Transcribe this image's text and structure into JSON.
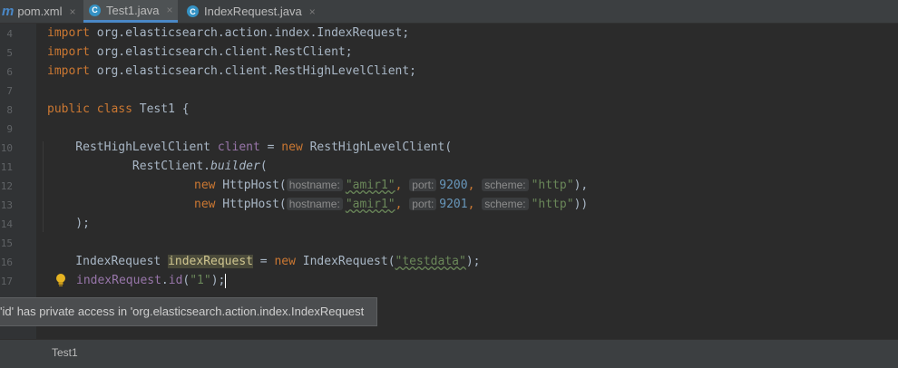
{
  "tabs": [
    {
      "label": "pom.xml",
      "icon": "maven-icon",
      "active": false
    },
    {
      "label": "Test1.java",
      "icon": "java-class-icon",
      "active": true
    },
    {
      "label": "IndexRequest.java",
      "icon": "java-class-icon",
      "active": false
    }
  ],
  "close_glyph": "×",
  "maven_glyph": "m",
  "class_glyph": "C",
  "line_numbers": [
    "4",
    "5",
    "6",
    "7",
    "8",
    "9",
    "10",
    "11",
    "12",
    "13",
    "14",
    "15",
    "16",
    "17"
  ],
  "code": {
    "l4_kw": "import",
    "l4_rest": " org.elasticsearch.action.index.IndexRequest;",
    "l5_kw": "import",
    "l5_rest": " org.elasticsearch.client.RestClient;",
    "l6_kw": "import",
    "l6_rest": " org.elasticsearch.client.RestHighLevelClient;",
    "l8_kw1": "public",
    "l8_kw2": " class",
    "l8_rest": " Test1 {",
    "l10_a": "    RestHighLevelClient ",
    "l10_field": "client",
    "l10_b": " = ",
    "l10_kw": "new",
    "l10_c": " RestHighLevelClient(",
    "l11_a": "            RestClient.",
    "l11_method": "builder",
    "l11_b": "(",
    "l12_kw": "new",
    "l12_a": " HttpHost(",
    "l12_h1": "hostname:",
    "l12_s1": "\"amir1\"",
    "l12_c1": ", ",
    "l12_h2": "port:",
    "l12_n": "9200",
    "l12_c2": ", ",
    "l12_h3": "scheme:",
    "l12_s3": "\"http\"",
    "l12_end": "),",
    "l13_kw": "new",
    "l13_a": " HttpHost(",
    "l13_h1": "hostname:",
    "l13_s1": "\"amir1\"",
    "l13_c1": ", ",
    "l13_h2": "port:",
    "l13_n": "9201",
    "l13_c2": ", ",
    "l13_h3": "scheme:",
    "l13_s3": "\"http\"",
    "l13_end": "))",
    "l14": "    );",
    "l16_a": "    IndexRequest ",
    "l16_var": "indexRequest",
    "l16_b": " = ",
    "l16_kw": "new",
    "l16_c": " IndexRequest(",
    "l16_s": "\"testdata\"",
    "l16_end": ");",
    "l17_var": "indexRequest",
    "l17_dot": ".",
    "l17_method": "id",
    "l17_a": "(",
    "l17_s": "\"1\"",
    "l17_end": ");"
  },
  "tooltip": "'id' has private access in 'org.elasticsearch.action.index.IndexRequest",
  "status_crumb": "Test1"
}
